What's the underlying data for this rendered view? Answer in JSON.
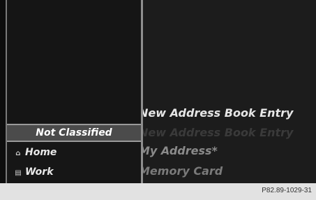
{
  "submenu": {
    "items": [
      {
        "label": "Not Classified",
        "icon": "",
        "selected": true
      },
      {
        "label": "Home",
        "icon": "home-icon",
        "selected": false
      },
      {
        "label": "Work",
        "icon": "work-icon",
        "selected": false
      }
    ]
  },
  "main_menu": {
    "items": [
      {
        "label": "New Address Book Entry",
        "state": "highlighted"
      },
      {
        "label": "New Address Book Entry",
        "state": "ghost"
      },
      {
        "label": "My Address*",
        "state": "dim"
      },
      {
        "label": "Memory Card",
        "state": "dim"
      }
    ]
  },
  "footer": {
    "code": "P82.89-1029-31"
  },
  "colors": {
    "screen_bg": "#1b1b1b",
    "highlight_text": "#e6e6e6",
    "dim_text": "#8a8a8a",
    "ghost_text": "#3a3a3a",
    "selected_bg": "#4b4b4b"
  }
}
